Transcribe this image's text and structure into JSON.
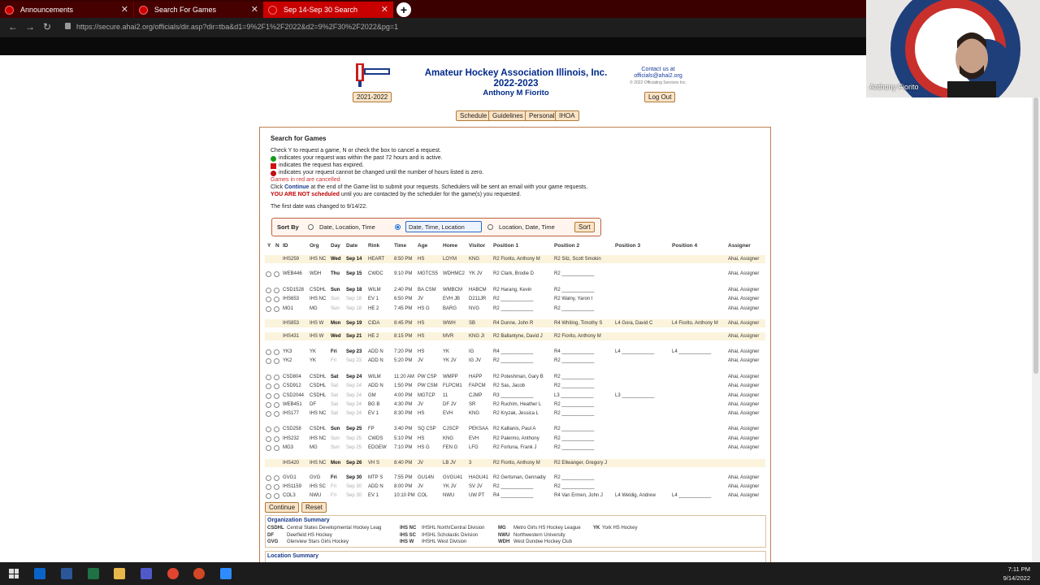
{
  "browser": {
    "tabs": [
      {
        "label": "Announcements"
      },
      {
        "label": "Search For Games"
      },
      {
        "label": "Sep 14-Sep 30 Search"
      }
    ],
    "url": "https://secure.ahai2.org/officials/dir.asp?dir=tba&d1=9%2F1%2F2022&d2=9%2F30%2F2022&pg=1"
  },
  "header": {
    "season_button": "2021-2022",
    "org_name": "Amateur Hockey Association Illinois, Inc.",
    "season": "2022-2023",
    "user_name": "Anthony M Fiorito",
    "contact_line1": "Contact us at",
    "contact_email": "officials@ahai2.org",
    "copyright": "© 2022 Officiating Services Inc.",
    "logout": "Log Out"
  },
  "nav": [
    "Schedule",
    "Guidelines",
    "Personal",
    "IHOA"
  ],
  "search": {
    "heading": "Search for Games",
    "intro": "Check Y to request a game, N or check the box to cancel a request.",
    "legend_green": "indicates your request was within the past 72 hours and is active.",
    "legend_red_sq": "indicates the request has expired.",
    "legend_red_dot": "indicates your request cannot be changed until the number of hours listed is zero.",
    "cancelled_note": "Games in red are cancelled",
    "continue_prefix": "Click",
    "continue_word": "Continue",
    "continue_suffix": "at the end of the Game list to submit your requests. Schedulers will be sent an email with your game requests.",
    "not_scheduled": "YOU ARE NOT scheduled",
    "not_scheduled_suffix": "until you are contacted by the scheduler for the game(s) you requested.",
    "first_date_note": "The first date was changed to 9/14/22."
  },
  "sort": {
    "label": "Sort By",
    "options": [
      "Date, Location, Time",
      "Date, Time, Location",
      "Location, Date, Time"
    ],
    "selected": "Date, Time, Location",
    "button": "Sort"
  },
  "columns": [
    "Y",
    "N",
    "ID",
    "Org",
    "Day",
    "Date",
    "Rink",
    "Time",
    "Age",
    "Home",
    "Visitor",
    "Position 1",
    "Position 2",
    "Position 3",
    "Position 4",
    "Assigner"
  ],
  "games": [
    {
      "id": "IHS259",
      "org": "IHS NC",
      "day": "Wed",
      "date": "Sep 14",
      "rink": "HEART",
      "time": "8:50 PM",
      "age": "HS",
      "home": "LOYM",
      "visitor": "KNG",
      "p1": "R2 Fiorito, Anthony M",
      "p2": "R2 Silz, Scott Smokin",
      "p3": "",
      "p4": "",
      "assigner": "Ahai, Assigner",
      "band": true,
      "checks": false,
      "bold": true
    },
    {
      "id": "WEB446",
      "org": "WDH",
      "day": "Thu",
      "date": "Sep 15",
      "rink": "CWDC",
      "time": "9:10 PM",
      "age": "MGTCS5",
      "home": "WDHMC2",
      "visitor": "YK JV",
      "p1": "R2 Clark, Brodie D",
      "p2": "R2 ____________",
      "p3": "",
      "p4": "",
      "assigner": "Ahai, Assigner",
      "band": false,
      "checks": true,
      "bold": true
    },
    {
      "id": "CSD1528",
      "org": "CSDHL",
      "day": "Sun",
      "date": "Sep 18",
      "rink": "WILM",
      "time": "2:40 PM",
      "age": "BA CSM",
      "home": "WMBCM",
      "visitor": "HABCM",
      "p1": "R2 Harang, Kevin",
      "p2": "R2 ____________",
      "p3": "",
      "p4": "",
      "assigner": "Ahai, Assigner",
      "band": false,
      "checks": true,
      "bold": true
    },
    {
      "id": "IHS653",
      "org": "IHS NC",
      "day": "Sun",
      "date": "Sep 18",
      "rink": "EV 1",
      "time": "6:50 PM",
      "age": "JV",
      "home": "EVH JB",
      "visitor": "D211JR",
      "p1": "R2 ____________",
      "p2": "R2 Walny, Yaron I",
      "p3": "",
      "p4": "",
      "assigner": "Ahai, Assigner",
      "band": false,
      "checks": true,
      "bold": false
    },
    {
      "id": "MG1",
      "org": "MG",
      "day": "Sun",
      "date": "Sep 18",
      "rink": "HE 2",
      "time": "7:45 PM",
      "age": "HS G",
      "home": "BARG",
      "visitor": "NVG",
      "p1": "R2 ____________",
      "p2": "R2 ____________",
      "p3": "",
      "p4": "",
      "assigner": "Ahai, Assigner",
      "band": false,
      "checks": true,
      "bold": false
    },
    {
      "id": "IHS853",
      "org": "IHS W",
      "day": "Mon",
      "date": "Sep 19",
      "rink": "CIDA",
      "time": "8:45 PM",
      "age": "HS",
      "home": "WWH",
      "visitor": "SB",
      "p1": "R4 Dunne, John R",
      "p2": "R4 Whiting, Timothy S",
      "p3": "L4 Gora, David C",
      "p4": "L4 Fiorito, Anthony M",
      "assigner": "Ahai, Assigner",
      "band": true,
      "checks": false,
      "bold": true
    },
    {
      "id": "IHS431",
      "org": "IHS W",
      "day": "Wed",
      "date": "Sep 21",
      "rink": "HE 2",
      "time": "8:15 PM",
      "age": "HS",
      "home": "MVR",
      "visitor": "KNG JI",
      "p1": "R2 Ballantyne, David J",
      "p2": "R2 Fiorito, Anthony M",
      "p3": "",
      "p4": "",
      "assigner": "Ahai, Assigner",
      "band": true,
      "checks": false,
      "bold": true
    },
    {
      "id": "YK3",
      "org": "YK",
      "day": "Fri",
      "date": "Sep 23",
      "rink": "ADD N",
      "time": "7:20 PM",
      "age": "HS",
      "home": "YK",
      "visitor": "IG",
      "p1": "R4 ____________",
      "p2": "R4 ____________",
      "p3": "L4 ____________",
      "p4": "L4 ____________",
      "assigner": "Ahai, Assigner",
      "band": false,
      "checks": true,
      "bold": true
    },
    {
      "id": "YK2",
      "org": "YK",
      "day": "Fri",
      "date": "Sep 23",
      "rink": "ADD N",
      "time": "5:20 PM",
      "age": "JV",
      "home": "YK JV",
      "visitor": "IG JV",
      "p1": "R2 ____________",
      "p2": "R2 ____________",
      "p3": "",
      "p4": "",
      "assigner": "Ahai, Assigner",
      "band": false,
      "checks": true,
      "bold": false
    },
    {
      "id": "CSD804",
      "org": "CSDHL",
      "day": "Sat",
      "date": "Sep 24",
      "rink": "WILM",
      "time": "11:20 AM",
      "age": "PW CSP",
      "home": "WMPP",
      "visitor": "HAPP",
      "p1": "R2 Poteshman, Gary B",
      "p2": "R2 ____________",
      "p3": "",
      "p4": "",
      "assigner": "Ahai, Assigner",
      "band": false,
      "checks": true,
      "bold": true
    },
    {
      "id": "CSD912",
      "org": "CSDHL",
      "day": "Sat",
      "date": "Sep 24",
      "rink": "ADD N",
      "time": "1:50 PM",
      "age": "PW CSM",
      "home": "FLPCM1",
      "visitor": "FAPCM",
      "p1": "R2 Sas, Jacob",
      "p2": "R2 ____________",
      "p3": "",
      "p4": "",
      "assigner": "Ahai, Assigner",
      "band": false,
      "checks": true,
      "bold": false
    },
    {
      "id": "CSD2044",
      "org": "CSDHL",
      "day": "Sat",
      "date": "Sep 24",
      "rink": "GM",
      "time": "4:00 PM",
      "age": "MGTCP",
      "home": "11",
      "visitor": "CJMP",
      "p1": "R3 ____________",
      "p2": "L3 ____________",
      "p3": "L3 ____________",
      "p4": "",
      "assigner": "Ahai, Assigner",
      "band": false,
      "checks": true,
      "bold": false
    },
    {
      "id": "WEB451",
      "org": "DF",
      "day": "Sat",
      "date": "Sep 24",
      "rink": "BG B",
      "time": "4:30 PM",
      "age": "JV",
      "home": "DF JV",
      "visitor": "SR",
      "p1": "R2 Ruchim, Heather L",
      "p2": "R2 ____________",
      "p3": "",
      "p4": "",
      "assigner": "Ahai, Assigner",
      "band": false,
      "checks": true,
      "bold": false
    },
    {
      "id": "IHS177",
      "org": "IHS NC",
      "day": "Sat",
      "date": "Sep 24",
      "rink": "EV 1",
      "time": "8:30 PM",
      "age": "HS",
      "home": "EVH",
      "visitor": "KNG",
      "p1": "R2 Kryzak, Jessica L",
      "p2": "R2 ____________",
      "p3": "",
      "p4": "",
      "assigner": "Ahai, Assigner",
      "band": false,
      "checks": true,
      "bold": false
    },
    {
      "id": "CSD258",
      "org": "CSDHL",
      "day": "Sun",
      "date": "Sep 25",
      "rink": "FP",
      "time": "3:40 PM",
      "age": "SQ CSP",
      "home": "CJSCP",
      "visitor": "PEKSAA",
      "p1": "R2 Kallianis, Paul A",
      "p2": "R2 ____________",
      "p3": "",
      "p4": "",
      "assigner": "Ahai, Assigner",
      "band": false,
      "checks": true,
      "bold": true
    },
    {
      "id": "IHS232",
      "org": "IHS NC",
      "day": "Sun",
      "date": "Sep 25",
      "rink": "CWDS",
      "time": "5:10 PM",
      "age": "HS",
      "home": "KNG",
      "visitor": "EVH",
      "p1": "R2 Palermo, Anthony",
      "p2": "R2 ____________",
      "p3": "",
      "p4": "",
      "assigner": "Ahai, Assigner",
      "band": false,
      "checks": true,
      "bold": false
    },
    {
      "id": "MG3",
      "org": "MG",
      "day": "Sun",
      "date": "Sep 25",
      "rink": "EDGEW",
      "time": "7:10 PM",
      "age": "HS G",
      "home": "FEN G",
      "visitor": "LFG",
      "p1": "R2 Fortuna, Frank J",
      "p2": "R2 ____________",
      "p3": "",
      "p4": "",
      "assigner": "Ahai, Assigner",
      "band": false,
      "checks": true,
      "bold": false
    },
    {
      "id": "IHS420",
      "org": "IHS NC",
      "day": "Mon",
      "date": "Sep 26",
      "rink": "VH S",
      "time": "8:40 PM",
      "age": "JV",
      "home": "LB JV",
      "visitor": "3",
      "p1": "R2 Fiorito, Anthony M",
      "p2": "R2 Ellwanger, Gregory J",
      "p3": "",
      "p4": "",
      "assigner": "",
      "band": true,
      "checks": false,
      "bold": true
    },
    {
      "id": "GVG1",
      "org": "GVG",
      "day": "Fri",
      "date": "Sep 30",
      "rink": "MTP S",
      "time": "7:55 PM",
      "age": "GU14N",
      "home": "GVGU41",
      "visitor": "HAGU41",
      "p1": "R2 Gertsman, Gennadiy",
      "p2": "R2 ____________",
      "p3": "",
      "p4": "",
      "assigner": "Ahai, Assigner",
      "band": false,
      "checks": true,
      "bold": true
    },
    {
      "id": "IHS1159",
      "org": "IHS SC",
      "day": "Fri",
      "date": "Sep 30",
      "rink": "ADD N",
      "time": "8:00 PM",
      "age": "JV",
      "home": "YK JV",
      "visitor": "SV JV",
      "p1": "R2 ____________",
      "p2": "R2 ____________",
      "p3": "",
      "p4": "",
      "assigner": "Ahai, Assigner",
      "band": false,
      "checks": true,
      "bold": false
    },
    {
      "id": "COL3",
      "org": "NWU",
      "day": "Fri",
      "date": "Sep 30",
      "rink": "EV 1",
      "time": "10:10 PM",
      "age": "COL",
      "home": "NWU",
      "visitor": "UW PT",
      "p1": "R4 ____________",
      "p2": "R4 Van Ermen, John J",
      "p3": "L4 Weldig, Andrew",
      "p4": "L4 ____________",
      "assigner": "Ahai, Assigner",
      "band": false,
      "checks": true,
      "bold": false
    }
  ],
  "actions": {
    "continue": "Continue",
    "reset": "Reset"
  },
  "org_summary": {
    "title": "Organization Summary",
    "entries": [
      {
        "code": "CSDHL",
        "name": "Central States Developmental Hockey Leag"
      },
      {
        "code": "DF",
        "name": "Deerfield HS Hockey"
      },
      {
        "code": "GVG",
        "name": "Glenview Stars Girls Hockey"
      },
      {
        "code": "IHS NC",
        "name": "IHSHL North/Central Division"
      },
      {
        "code": "IHS SC",
        "name": "IHSHL Scholastic Division"
      },
      {
        "code": "IHS W",
        "name": "IHSHL West Division"
      },
      {
        "code": "MG",
        "name": "Metro Girls HS Hockey League"
      },
      {
        "code": "NWU",
        "name": "Northwestern University"
      },
      {
        "code": "WDH",
        "name": "West Dundee Hockey Club"
      },
      {
        "code": "YK",
        "name": "York HS Hockey"
      }
    ]
  },
  "location_summary": {
    "title": "Location Summary"
  },
  "webcam": {
    "name": "Anthony Fiorito"
  },
  "clock": {
    "time": "7:11 PM",
    "date": "9/14/2022"
  }
}
